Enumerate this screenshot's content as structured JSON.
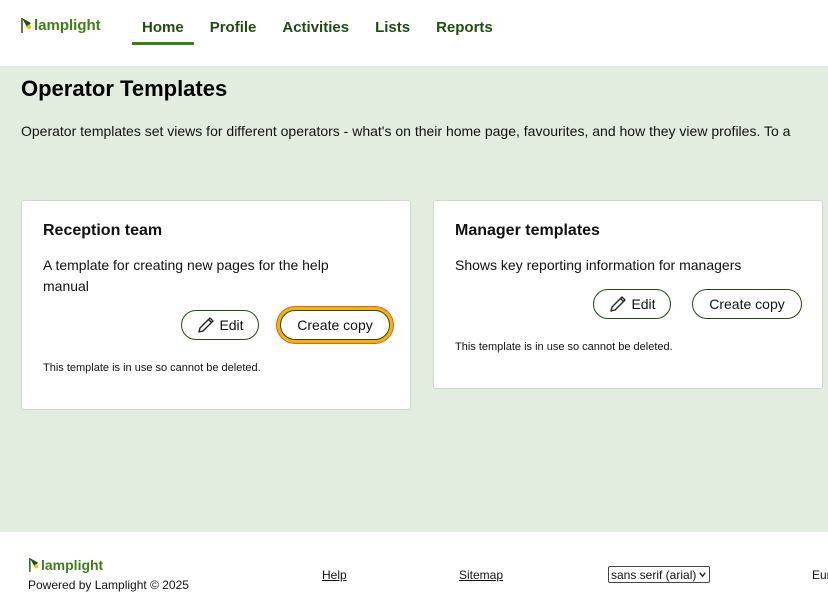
{
  "header": {
    "logo_text": "lamplight",
    "nav": [
      "Home",
      "Profile",
      "Activities",
      "Lists",
      "Reports"
    ],
    "active_nav": "Home"
  },
  "main": {
    "title": "Operator Templates",
    "intro": "Operator templates set views for different operators - what's on their home page, favourites, and how they view profiles. To a",
    "cards": [
      {
        "title": "Reception team",
        "description": "A template for creating new pages for the help manual",
        "edit_label": "Edit",
        "copy_label": "Create copy",
        "note": "This template is in use so cannot be deleted."
      },
      {
        "title": "Manager templates",
        "description": "Shows key reporting information for managers",
        "edit_label": "Edit",
        "copy_label": "Create copy",
        "note": "This template is in use so cannot be deleted."
      }
    ]
  },
  "footer": {
    "logo_text": "lamplight",
    "powered_by": "Powered by Lamplight © 2025",
    "help_link": "Help",
    "sitemap_link": "Sitemap",
    "font_select_value": "sans serif (arial)",
    "truncated_text": "Eur"
  },
  "colors": {
    "brand_green": "#3f7f1a",
    "nav_text": "#1f4d12",
    "page_background": "#e2ede0",
    "focus_ring": "#f5b400"
  }
}
